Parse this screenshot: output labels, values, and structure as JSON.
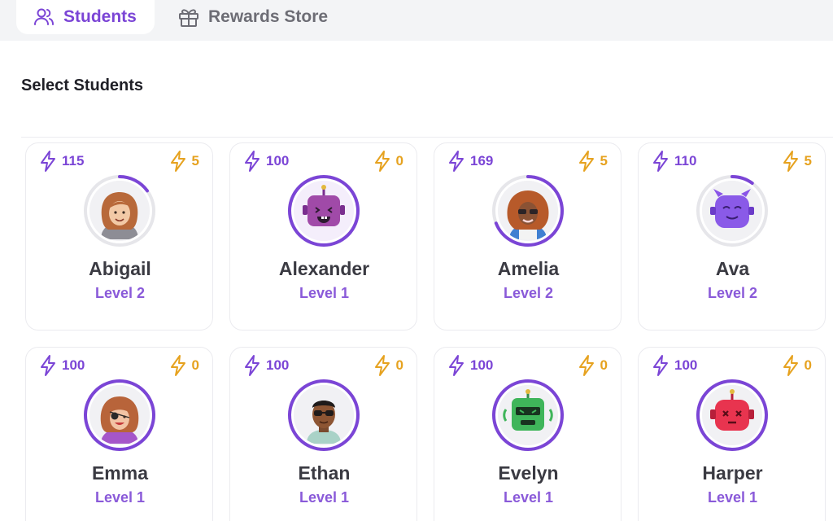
{
  "tabs": [
    {
      "label": "Students",
      "icon": "users-icon",
      "active": true
    },
    {
      "label": "Rewards Store",
      "icon": "gift-icon",
      "active": false
    }
  ],
  "section_title": "Select Students",
  "colors": {
    "accent": "#7b45d6",
    "gold": "#e6a21f",
    "ring_track": "#e6e6ea"
  },
  "students": [
    {
      "name": "Abigail",
      "level": "Level 2",
      "points": "115",
      "coins": "5",
      "progress": 0.15,
      "avatar": "girl-brown-hair-avatar"
    },
    {
      "name": "Alexander",
      "level": "Level 1",
      "points": "100",
      "coins": "0",
      "progress": 1.0,
      "avatar": "purple-monster-avatar"
    },
    {
      "name": "Amelia",
      "level": "Level 2",
      "points": "169",
      "coins": "5",
      "progress": 0.69,
      "avatar": "girl-curly-hair-sunglasses-avatar"
    },
    {
      "name": "Ava",
      "level": "Level 2",
      "points": "110",
      "coins": "5",
      "progress": 0.1,
      "avatar": "purple-horned-monster-avatar"
    },
    {
      "name": "Emma",
      "level": "Level 1",
      "points": "100",
      "coins": "0",
      "progress": 1.0,
      "avatar": "girl-eyepatch-avatar"
    },
    {
      "name": "Ethan",
      "level": "Level 1",
      "points": "100",
      "coins": "0",
      "progress": 1.0,
      "avatar": "boy-sunglasses-avatar"
    },
    {
      "name": "Evelyn",
      "level": "Level 1",
      "points": "100",
      "coins": "0",
      "progress": 1.0,
      "avatar": "green-robot-avatar"
    },
    {
      "name": "Harper",
      "level": "Level 1",
      "points": "100",
      "coins": "0",
      "progress": 1.0,
      "avatar": "red-robot-avatar"
    }
  ]
}
